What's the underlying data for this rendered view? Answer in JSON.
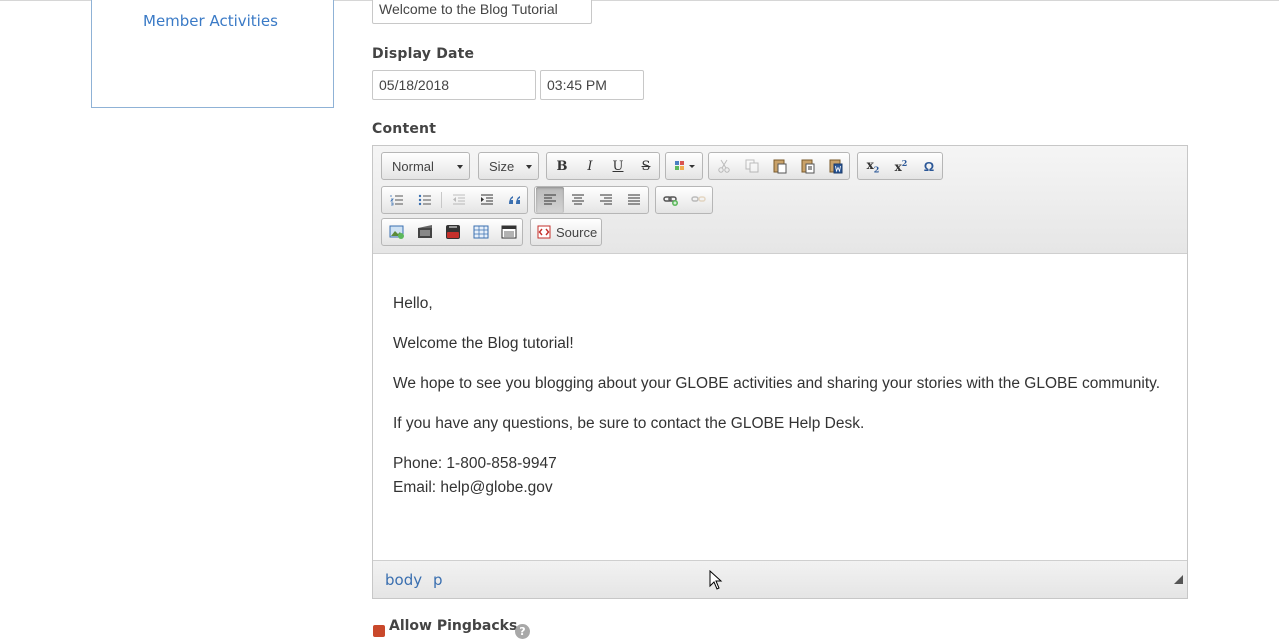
{
  "sidebar": {
    "member_activities": "Member Activities"
  },
  "form": {
    "title_value": "Welcome to the Blog Tutorial",
    "display_date_label": "Display Date",
    "date_value": "05/18/2018",
    "time_value": "03:45 PM",
    "content_label": "Content",
    "allow_pingbacks_label": "Allow Pingbacks",
    "allow_pingbacks_checked": true,
    "help_glyph": "?"
  },
  "editor": {
    "format_combo": "Normal",
    "size_combo": "Size",
    "source_label": "Source",
    "toolbar_glyphs": {
      "bold": "B",
      "italic": "I",
      "underline": "U",
      "strike": "S",
      "omega": "Ω"
    },
    "content": {
      "greeting": "Hello,",
      "welcome": "Welcome the Blog tutorial!",
      "hope": "We hope to see you blogging about your GLOBE activities and sharing your stories with the GLOBE community.",
      "questions": "If you have any questions, be sure to contact the GLOBE Help Desk.",
      "phone": "Phone: 1-800-858-9947",
      "email": "Email: help@globe.gov"
    },
    "path": [
      "body",
      "p"
    ]
  },
  "colors": {
    "link": "#3a7ac6",
    "path_link": "#3a6fb0",
    "checkbox": "#c9482b",
    "sidebar_border": "#8fb2d6"
  }
}
